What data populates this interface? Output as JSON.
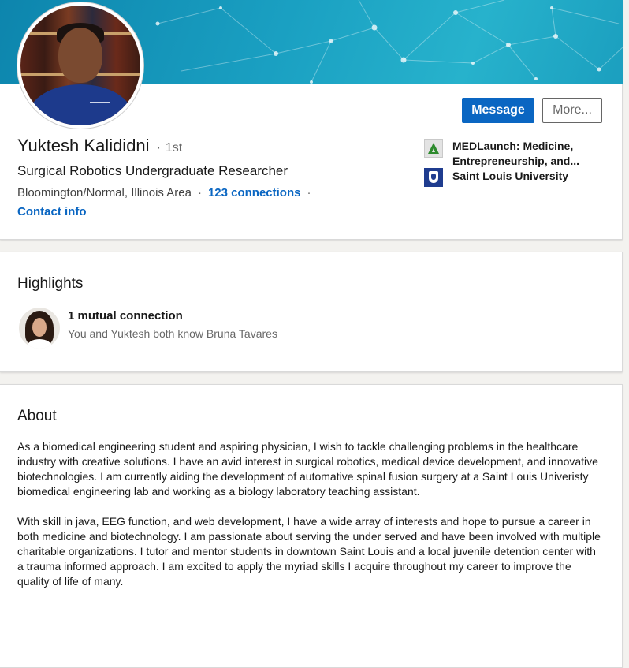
{
  "profile": {
    "name": "Yuktesh Kalididni",
    "degree": "1st",
    "headline": "Surgical Robotics Undergraduate Researcher",
    "location": "Bloomington/Normal, Illinois Area",
    "connections": "123 connections",
    "contact_info": "Contact info"
  },
  "actions": {
    "message_label": "Message",
    "more_label": "More..."
  },
  "experience": [
    {
      "name": "MEDLaunch: Medicine, Entrepreneurship, and...",
      "icon": "medlaunch-logo-icon"
    },
    {
      "name": "Saint Louis University",
      "icon": "slu-logo-icon"
    }
  ],
  "highlights": {
    "title": "Highlights",
    "mutual_title": "1 mutual connection",
    "mutual_sub": "You and Yuktesh both know Bruna Tavares"
  },
  "about": {
    "title": "About",
    "paragraphs": [
      "As a biomedical engineering student and aspiring physician, I wish to tackle challenging problems in the healthcare industry with creative solutions. I have an avid interest in surgical robotics, medical device development, and innovative biotechnologies. I am currently aiding the development of automative spinal fusion surgery at a Saint Louis Univeristy biomedical engineering lab and working as a biology laboratory teaching assistant.",
      "With skill in java, EEG function, and web development, I have a wide array of interests and hope to pursue a career in both medicine and biotechnology. I am passionate about serving the under served and have been involved with multiple charitable organizations. I tutor and mentor students in downtown Saint Louis and a local juvenile detention center with a trauma informed approach. I am excited to apply the myriad skills I acquire throughout my career to improve the quality of life of many."
    ]
  },
  "colors": {
    "accent": "#0a66c2",
    "banner": "#1aa0c2"
  }
}
